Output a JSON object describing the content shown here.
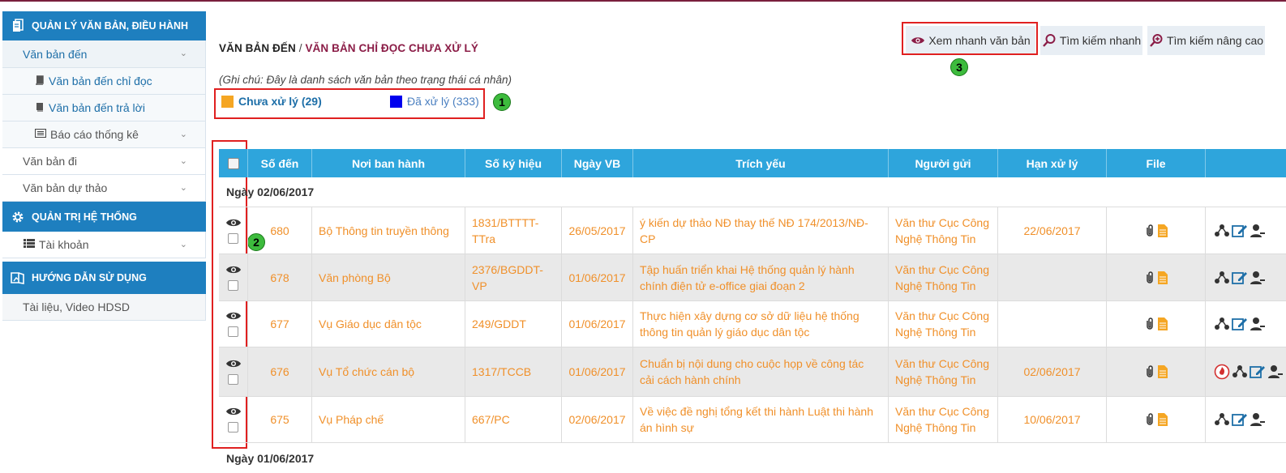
{
  "sidebar": {
    "sections": [
      {
        "title": "QUẢN LÝ VĂN BẢN, ĐIỀU HÀNH"
      },
      {
        "title": "QUẢN TRỊ HỆ THỐNG"
      },
      {
        "title": "HƯỚNG DẪN SỬ DỤNG"
      }
    ],
    "items": {
      "incoming": "Văn bản đến",
      "incoming_readonly": "Văn bản đến chỉ đọc",
      "incoming_reply": "Văn bản đến trả lời",
      "report": "Báo cáo thống kê",
      "outgoing": "Văn bản đi",
      "draft": "Văn bản dự thảo",
      "account": "Tài khoản",
      "docs": "Tài liệu, Video HDSD"
    }
  },
  "breadcrumb": {
    "root": "VĂN BẢN ĐẾN",
    "separator": "/",
    "current": "VĂN BẢN CHỈ ĐỌC CHƯA XỬ LÝ"
  },
  "toolbar": {
    "quick_view": "Xem nhanh văn bản",
    "quick_search": "Tìm kiếm nhanh",
    "advanced_search": "Tìm kiếm nâng cao"
  },
  "note": "(Ghi chú: Đây là danh sách văn bản theo trạng thái cá nhân)",
  "legend": {
    "pending": {
      "label": "Chưa xử lý (29)",
      "color": "#f5a623"
    },
    "done": {
      "label": "Đã xử lý (333)",
      "color": "#0000ee"
    }
  },
  "badges": [
    "1",
    "2",
    "3"
  ],
  "table": {
    "headers": {
      "number": "Số đến",
      "issuer": "Nơi ban hành",
      "code": "Số ký hiệu",
      "date": "Ngày VB",
      "summary": "Trích yếu",
      "sender": "Người gửi",
      "due": "Hạn xử lý",
      "file": "File"
    },
    "group": "Ngày 02/06/2017",
    "rows": [
      {
        "number": "680",
        "issuer": "Bộ Thông tin truyền thông",
        "code": "1831/BTTTT-TTra",
        "date": "26/05/2017",
        "summary": "ý kiến dự thảo NĐ thay thế NĐ 174/2013/NĐ-CP",
        "sender": "Văn thư Cục Công Nghệ Thông Tin",
        "due": "22/06/2017"
      },
      {
        "number": "678",
        "issuer": "Văn phòng Bộ",
        "code": "2376/BGDDT-VP",
        "date": "01/06/2017",
        "summary": "Tập huấn triển khai Hệ thống quản lý hành chính điện tử e-office giai đoạn 2",
        "sender": "Văn thư Cục Công Nghệ Thông Tin",
        "due": ""
      },
      {
        "number": "677",
        "issuer": "Vụ Giáo dục dân tộc",
        "code": "249/GDDT",
        "date": "01/06/2017",
        "summary": "Thực hiện xây dựng cơ sở dữ liệu hệ thống thông tin quản lý giáo dục dân tộc",
        "sender": "Văn thư Cục Công Nghệ Thông Tin",
        "due": ""
      },
      {
        "number": "676",
        "issuer": "Vụ Tổ chức cán bộ",
        "code": "1317/TCCB",
        "date": "01/06/2017",
        "summary": "Chuẩn bị nội dung cho cuộc họp về công tác cải cách hành chính",
        "sender": "Văn thư Cục Công Nghệ Thông Tin",
        "due": "02/06/2017"
      },
      {
        "number": "675",
        "issuer": "Vụ Pháp chế",
        "code": "667/PC",
        "date": "02/06/2017",
        "summary": "Về việc đề nghị tổng kết thi hành Luật thi hành án hình sự",
        "sender": "Văn thư Cục Công Nghệ Thông Tin",
        "due": "10/06/2017"
      }
    ],
    "next_group": "Ngày 01/06/2017"
  }
}
